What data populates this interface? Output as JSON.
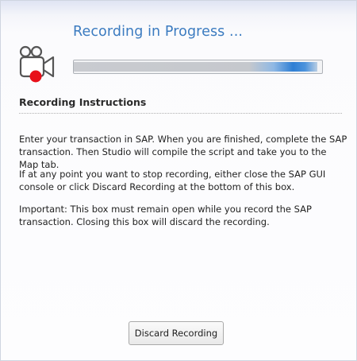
{
  "header": {
    "title": "Recording in Progress ...",
    "icon": "movie-camera-record-icon",
    "progress": 0.98
  },
  "instructions": {
    "heading": "Recording Instructions",
    "paragraphs": [
      "Enter your transaction in SAP. When you are finished, complete the SAP transaction. Then Studio will compile the script and take you to the Map tab.",
      "If at any point you want to stop recording, either close the SAP GUI console or click Discard Recording at the bottom of this box.",
      "Important: This box must remain open while you record the SAP transaction. Closing this box will discard the recording."
    ]
  },
  "footer": {
    "discard_label": "Discard Recording"
  },
  "colors": {
    "title": "#3b7bc0",
    "record_dot": "#e8101a",
    "progress_accent": "#2f7fd4"
  }
}
